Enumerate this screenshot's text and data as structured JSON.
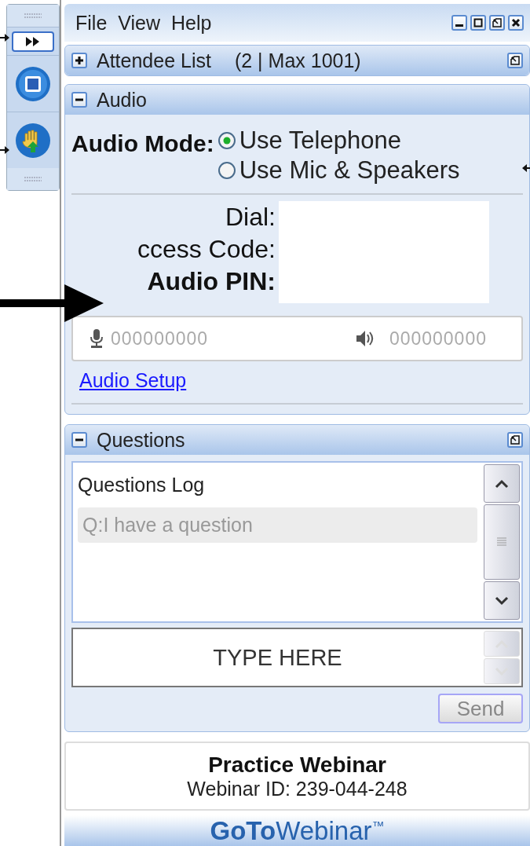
{
  "menu": [
    "File",
    "View",
    "Help"
  ],
  "attendee_pane": {
    "title": "Attendee List",
    "count": "(2 | Max 1001)",
    "expanded": false
  },
  "audio_pane": {
    "title": "Audio",
    "expanded": true,
    "mode_label": "Audio Mode:",
    "modes": [
      {
        "label": "Use Telephone",
        "selected": true
      },
      {
        "label": "Use Mic & Speakers",
        "selected": false
      }
    ],
    "fields": [
      {
        "label": "Dial:",
        "bold": false
      },
      {
        "label": "ccess Code:",
        "bold": false
      },
      {
        "label": "Audio PIN:",
        "bold": true
      }
    ],
    "mic_level": "000000000",
    "speaker_level": "000000000",
    "setup_link": "Audio Setup"
  },
  "questions_pane": {
    "title": "Questions",
    "expanded": true,
    "log_title": "Questions Log",
    "items": [
      "Q:I have a question"
    ],
    "input_value": "TYPE HERE",
    "send": {
      "label": "Send",
      "disabled": true
    }
  },
  "webinar": {
    "title": "Practice Webinar",
    "id": "Webinar ID: 239-044-248"
  },
  "brand": {
    "bold": "GoTo",
    "light": "Webinar",
    "mark": "™"
  }
}
